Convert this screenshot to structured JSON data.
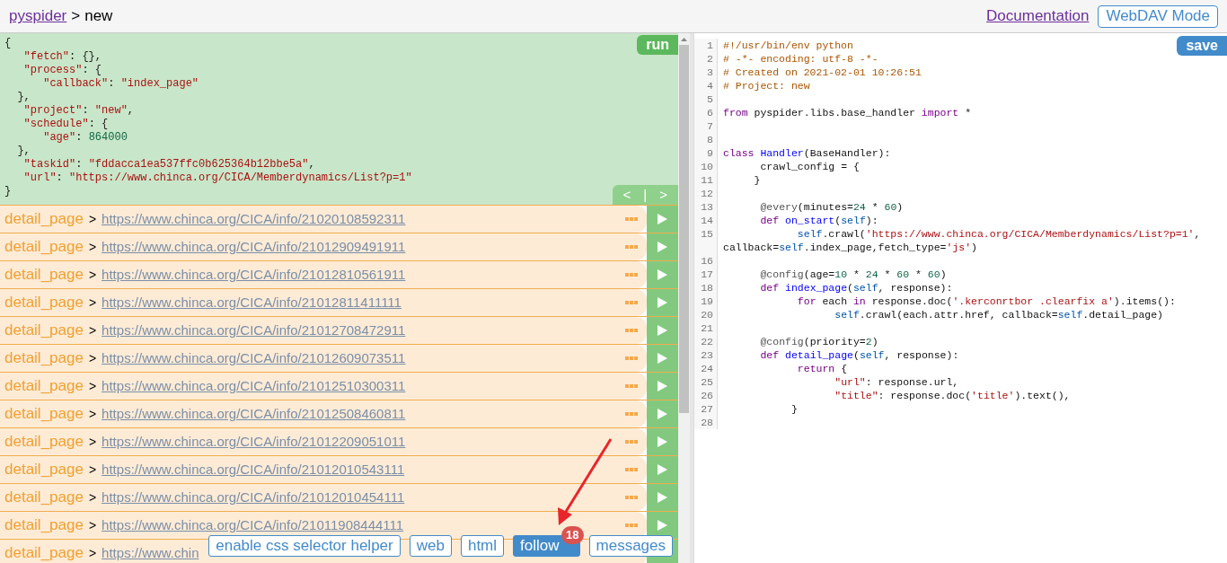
{
  "header": {
    "home_link": "pyspider",
    "separator": ">",
    "project": "new",
    "doc_link": "Documentation",
    "webdav_button": "WebDAV Mode"
  },
  "task": {
    "run_button": "run",
    "prev": "<",
    "divider": "|",
    "next": ">",
    "lines": [
      [
        {
          "kind": "plain",
          "text": "{"
        }
      ],
      [
        {
          "kind": "key",
          "text": "   \"fetch\""
        },
        {
          "kind": "plain",
          "text": ": {},"
        }
      ],
      [
        {
          "kind": "key",
          "text": "   \"process\""
        },
        {
          "kind": "plain",
          "text": ": {"
        }
      ],
      [
        {
          "kind": "key",
          "text": "      \"callback\""
        },
        {
          "kind": "plain",
          "text": ": "
        },
        {
          "kind": "string",
          "text": "\"index_page\""
        }
      ],
      [
        {
          "kind": "plain",
          "text": "  },"
        }
      ],
      [
        {
          "kind": "key",
          "text": "   \"project\""
        },
        {
          "kind": "plain",
          "text": ": "
        },
        {
          "kind": "string",
          "text": "\"new\""
        },
        {
          "kind": "plain",
          "text": ","
        }
      ],
      [
        {
          "kind": "key",
          "text": "   \"schedule\""
        },
        {
          "kind": "plain",
          "text": ": {"
        }
      ],
      [
        {
          "kind": "key",
          "text": "      \"age\""
        },
        {
          "kind": "plain",
          "text": ": "
        },
        {
          "kind": "number",
          "text": "864000"
        }
      ],
      [
        {
          "kind": "plain",
          "text": "  },"
        }
      ],
      [
        {
          "kind": "key",
          "text": "   \"taskid\""
        },
        {
          "kind": "plain",
          "text": ": "
        },
        {
          "kind": "string",
          "text": "\"fddacca1ea537ffc0b625364b12bbe5a\""
        },
        {
          "kind": "plain",
          "text": ","
        }
      ],
      [
        {
          "kind": "key",
          "text": "   \"url\""
        },
        {
          "kind": "plain",
          "text": ": "
        },
        {
          "kind": "string",
          "text": "\"https://www.chinca.org/CICA/Memberdynamics/List?p=1\""
        }
      ],
      [
        {
          "kind": "plain",
          "text": "}"
        }
      ]
    ]
  },
  "follows": [
    {
      "callback": "detail_page",
      "sep": ">",
      "url": "https://www.chinca.org/CICA/info/21020108592311",
      "actions": true
    },
    {
      "callback": "detail_page",
      "sep": ">",
      "url": "https://www.chinca.org/CICA/info/21012909491911",
      "actions": true
    },
    {
      "callback": "detail_page",
      "sep": ">",
      "url": "https://www.chinca.org/CICA/info/21012810561911",
      "actions": true
    },
    {
      "callback": "detail_page",
      "sep": ">",
      "url": "https://www.chinca.org/CICA/info/21012811411111",
      "actions": true
    },
    {
      "callback": "detail_page",
      "sep": ">",
      "url": "https://www.chinca.org/CICA/info/21012708472911",
      "actions": true
    },
    {
      "callback": "detail_page",
      "sep": ">",
      "url": "https://www.chinca.org/CICA/info/21012609073511",
      "actions": true
    },
    {
      "callback": "detail_page",
      "sep": ">",
      "url": "https://www.chinca.org/CICA/info/21012510300311",
      "actions": true
    },
    {
      "callback": "detail_page",
      "sep": ">",
      "url": "https://www.chinca.org/CICA/info/21012508460811",
      "actions": true
    },
    {
      "callback": "detail_page",
      "sep": ">",
      "url": "https://www.chinca.org/CICA/info/21012209051011",
      "actions": true
    },
    {
      "callback": "detail_page",
      "sep": ">",
      "url": "https://www.chinca.org/CICA/info/21012010543111",
      "actions": true
    },
    {
      "callback": "detail_page",
      "sep": ">",
      "url": "https://www.chinca.org/CICA/info/21012010454111",
      "actions": true
    },
    {
      "callback": "detail_page",
      "sep": ">",
      "url": "https://www.chinca.org/CICA/info/21011908444111",
      "actions": true
    },
    {
      "callback": "detail_page",
      "sep": ">",
      "url": "https://www.chin"
    }
  ],
  "tabs": [
    {
      "label": "enable css selector helper",
      "selected": false
    },
    {
      "label": "web",
      "selected": false
    },
    {
      "label": "html",
      "selected": false
    },
    {
      "label": "follow",
      "selected": true,
      "badge": "18"
    },
    {
      "label": "messages",
      "selected": false
    }
  ],
  "editor": {
    "save_button": "save",
    "lines": [
      {
        "n": "1",
        "t": [
          {
            "kind": "comment",
            "text": "#!/usr/bin/env python"
          }
        ]
      },
      {
        "n": "2",
        "t": [
          {
            "kind": "comment",
            "text": "# -*- encoding: utf-8 -*-"
          }
        ]
      },
      {
        "n": "3",
        "t": [
          {
            "kind": "comment",
            "text": "# Created on 2021-02-01 10:26:51"
          }
        ]
      },
      {
        "n": "4",
        "t": [
          {
            "kind": "comment",
            "text": "# Project: new"
          }
        ]
      },
      {
        "n": "5"
      },
      {
        "n": "6",
        "t": [
          {
            "kind": "keyword",
            "text": "from"
          },
          {
            "kind": "plain",
            "text": " pyspider.libs.base_handler "
          },
          {
            "kind": "keyword",
            "text": "import"
          },
          {
            "kind": "plain",
            "text": " *"
          }
        ]
      },
      {
        "n": "7"
      },
      {
        "n": "8"
      },
      {
        "n": "9",
        "t": [
          {
            "kind": "keyword",
            "text": "class"
          },
          {
            "kind": "def",
            "text": " Handler"
          },
          {
            "kind": "plain",
            "text": "(BaseHandler):"
          }
        ]
      },
      {
        "n": "10",
        "t": [
          {
            "kind": "plain",
            "text": "      crawl_config = {"
          }
        ]
      },
      {
        "n": "11",
        "t": [
          {
            "kind": "plain",
            "text": "     }"
          }
        ]
      },
      {
        "n": "12"
      },
      {
        "n": "13",
        "t": [
          {
            "kind": "decorator",
            "text": "      @every"
          },
          {
            "kind": "plain",
            "text": "(minutes="
          },
          {
            "kind": "number",
            "text": "24"
          },
          {
            "kind": "plain",
            "text": " * "
          },
          {
            "kind": "number",
            "text": "60"
          },
          {
            "kind": "plain",
            "text": ")"
          }
        ]
      },
      {
        "n": "14",
        "t": [
          {
            "kind": "keyword",
            "text": "      def"
          },
          {
            "kind": "def",
            "text": " on_start"
          },
          {
            "kind": "plain",
            "text": "("
          },
          {
            "kind": "self",
            "text": "self"
          },
          {
            "kind": "plain",
            "text": "):"
          }
        ]
      },
      {
        "n": "15",
        "t": [
          {
            "kind": "self",
            "text": "            self"
          },
          {
            "kind": "plain",
            "text": ".crawl("
          },
          {
            "kind": "string",
            "text": "'https://www.chinca.org/CICA/Memberdynamics/List?p=1'"
          },
          {
            "kind": "plain",
            "text": ", callback="
          },
          {
            "kind": "self",
            "text": "self"
          },
          {
            "kind": "plain",
            "text": ".index_page,fetch_type="
          },
          {
            "kind": "string",
            "text": "'js'"
          },
          {
            "kind": "plain",
            "text": ")"
          }
        ]
      },
      {
        "n": "16"
      },
      {
        "n": "17",
        "t": [
          {
            "kind": "decorator",
            "text": "      @config"
          },
          {
            "kind": "plain",
            "text": "(age="
          },
          {
            "kind": "number",
            "text": "10"
          },
          {
            "kind": "plain",
            "text": " * "
          },
          {
            "kind": "number",
            "text": "24"
          },
          {
            "kind": "plain",
            "text": " * "
          },
          {
            "kind": "number",
            "text": "60"
          },
          {
            "kind": "plain",
            "text": " * "
          },
          {
            "kind": "number",
            "text": "60"
          },
          {
            "kind": "plain",
            "text": ")"
          }
        ]
      },
      {
        "n": "18",
        "t": [
          {
            "kind": "keyword",
            "text": "      def"
          },
          {
            "kind": "def",
            "text": " index_page"
          },
          {
            "kind": "plain",
            "text": "("
          },
          {
            "kind": "self",
            "text": "self"
          },
          {
            "kind": "plain",
            "text": ", response):"
          }
        ]
      },
      {
        "n": "19",
        "t": [
          {
            "kind": "keyword",
            "text": "            for"
          },
          {
            "kind": "plain",
            "text": " each "
          },
          {
            "kind": "keyword",
            "text": "in"
          },
          {
            "kind": "plain",
            "text": " response.doc("
          },
          {
            "kind": "string",
            "text": "'.kerconrtbor .clearfix a'"
          },
          {
            "kind": "plain",
            "text": ").items():"
          }
        ]
      },
      {
        "n": "20",
        "t": [
          {
            "kind": "self",
            "text": "                  self"
          },
          {
            "kind": "plain",
            "text": ".crawl(each.attr.href, callback="
          },
          {
            "kind": "self",
            "text": "self"
          },
          {
            "kind": "plain",
            "text": ".detail_page)"
          }
        ]
      },
      {
        "n": "21"
      },
      {
        "n": "22",
        "t": [
          {
            "kind": "decorator",
            "text": "      @config"
          },
          {
            "kind": "plain",
            "text": "(priority="
          },
          {
            "kind": "number",
            "text": "2"
          },
          {
            "kind": "plain",
            "text": ")"
          }
        ]
      },
      {
        "n": "23",
        "t": [
          {
            "kind": "keyword",
            "text": "      def"
          },
          {
            "kind": "def",
            "text": " detail_page"
          },
          {
            "kind": "plain",
            "text": "("
          },
          {
            "kind": "self",
            "text": "self"
          },
          {
            "kind": "plain",
            "text": ", response):"
          }
        ]
      },
      {
        "n": "24",
        "t": [
          {
            "kind": "keyword",
            "text": "            return"
          },
          {
            "kind": "plain",
            "text": " {"
          }
        ]
      },
      {
        "n": "25",
        "t": [
          {
            "kind": "string",
            "text": "                  \"url\""
          },
          {
            "kind": "plain",
            "text": ": response.url,"
          }
        ]
      },
      {
        "n": "26",
        "t": [
          {
            "kind": "string",
            "text": "                  \"title\""
          },
          {
            "kind": "plain",
            "text": ": response.doc("
          },
          {
            "kind": "string",
            "text": "'title'"
          },
          {
            "kind": "plain",
            "text": ").text(),"
          }
        ]
      },
      {
        "n": "27",
        "t": [
          {
            "kind": "plain",
            "text": "           }"
          }
        ]
      },
      {
        "n": "28"
      }
    ]
  }
}
